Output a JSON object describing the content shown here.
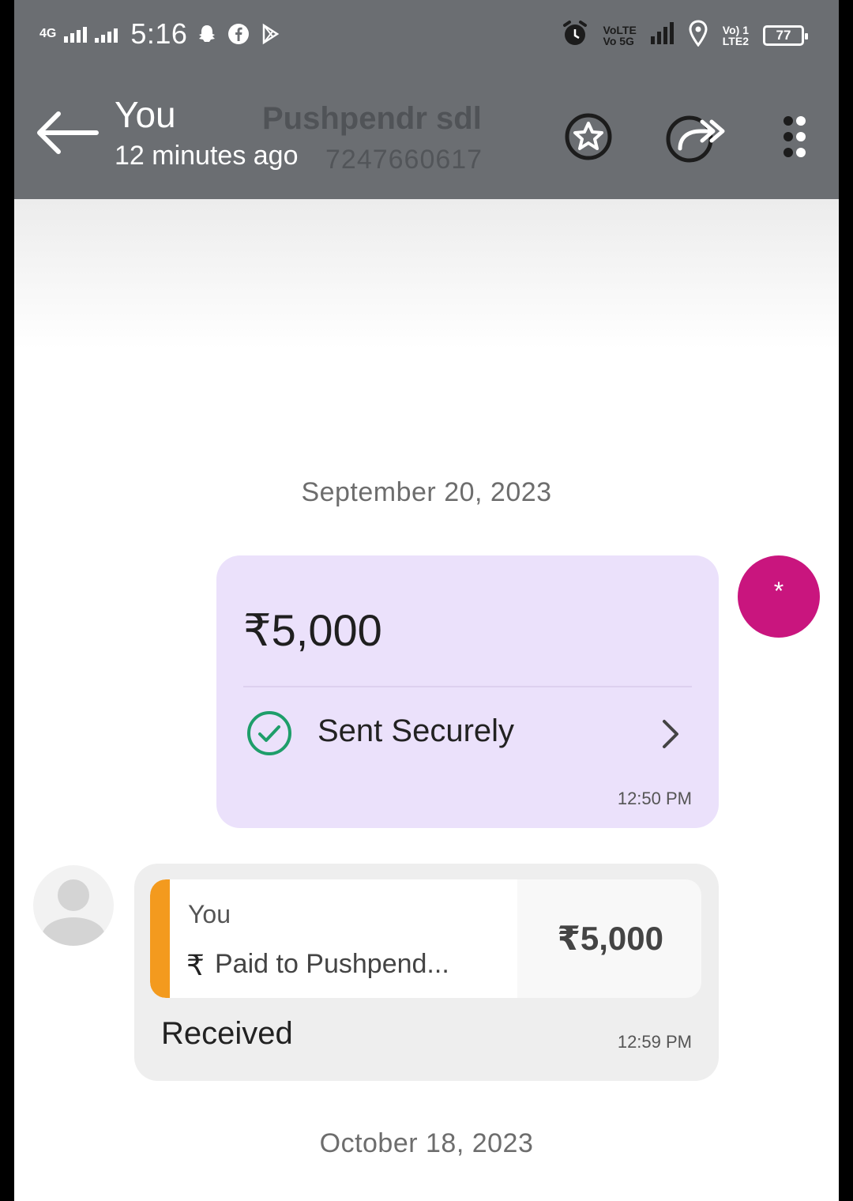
{
  "status_bar": {
    "network_type": "4G",
    "time": "5:16",
    "volte1": "VoLTE",
    "volte2": "Vo 5G",
    "lte_top": "Vo) 1",
    "lte_bottom": "LTE2",
    "battery": "77"
  },
  "header": {
    "title": "You",
    "subtitle": "12 minutes ago",
    "contact_name": "Pushpendr sdl",
    "contact_number": "7247660617",
    "icons": [
      "back-arrow-icon",
      "star-icon",
      "forward-icon",
      "more-vert-icon"
    ]
  },
  "chat": {
    "date_1": "September 20, 2023",
    "sent_payment": {
      "amount": "₹5,000",
      "status": "Sent Securely",
      "time": "12:50 PM"
    },
    "avatar_initial": "*",
    "received_payment": {
      "who": "You",
      "currency_icon": "₹",
      "description": "Paid to Pushpend...",
      "amount": "₹5,000",
      "status": "Received",
      "time": "12:59 PM"
    },
    "date_2": "October 18, 2023"
  },
  "colors": {
    "header_bg": "#6b6e72",
    "sent_card": "#ebe1fb",
    "check_green": "#1e9e6a",
    "avatar_pink": "#c9157e",
    "accent_orange": "#f39a1e"
  }
}
